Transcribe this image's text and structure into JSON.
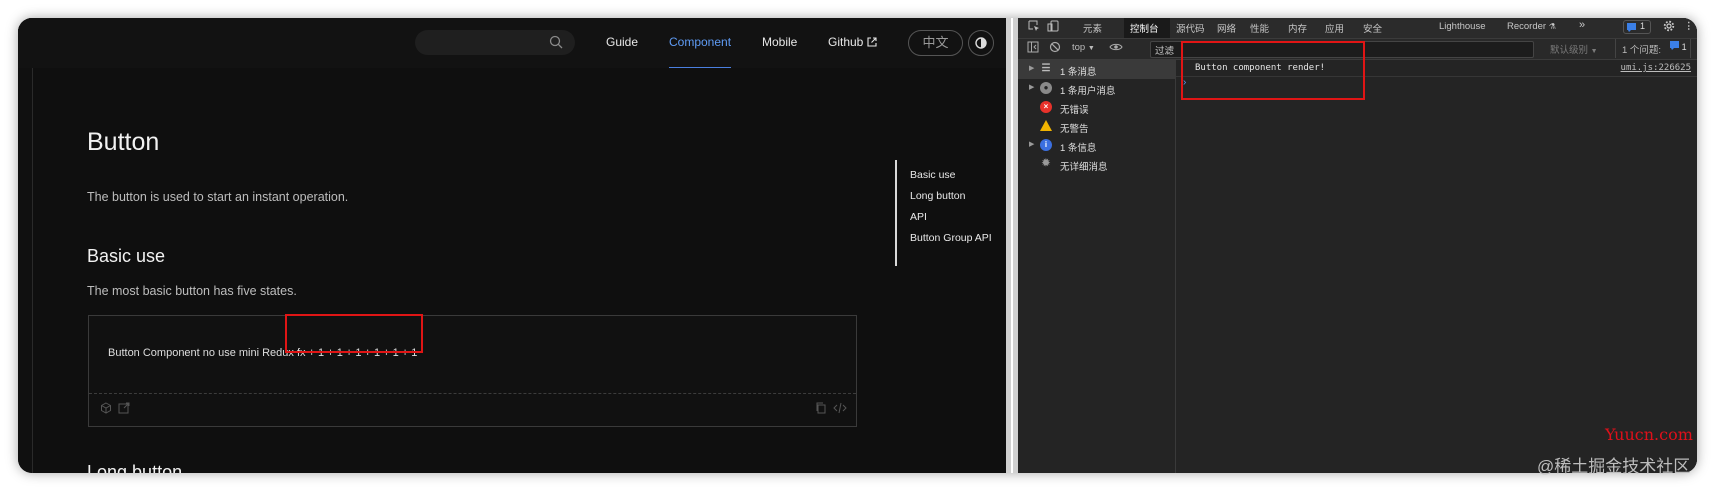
{
  "site": {
    "nav": {
      "search_placeholder": "",
      "links": [
        "Guide",
        "Component",
        "Mobile",
        "Github"
      ],
      "active": "Component",
      "lang": "中文"
    },
    "page": {
      "title": "Button",
      "intro": "The button is used to start an instant operation.",
      "section1_title": "Basic use",
      "section1_desc": "The most basic button has five states.",
      "demo_text": "Button Component no use mini Redux fx + 1 + 1 + 1 + 1 + 1 + 1",
      "section2_title": "Long button"
    },
    "toc": [
      "Basic use",
      "Long button",
      "API",
      "Button Group API"
    ]
  },
  "devtools": {
    "tabs": [
      "元素",
      "控制台",
      "源代码",
      "网络",
      "性能",
      "内存",
      "应用",
      "安全",
      "Lighthouse",
      "Recorder"
    ],
    "active_tab": "控制台",
    "issues_badge": "1",
    "toolbar": {
      "context": "top",
      "filter_value": "过滤",
      "level": "默认级别",
      "issues": "1 个问题:",
      "issues_count": "1"
    },
    "sidebar": [
      {
        "label": "1 条消息",
        "icon": "list-icon",
        "selected": true,
        "expandable": true
      },
      {
        "label": "1 条用户消息",
        "icon": "user-icon",
        "selected": false,
        "expandable": true
      },
      {
        "label": "无错误",
        "icon": "error-icon",
        "selected": false,
        "expandable": false
      },
      {
        "label": "无警告",
        "icon": "warning-icon",
        "selected": false,
        "expandable": false
      },
      {
        "label": "1 条信息",
        "icon": "info-icon",
        "selected": false,
        "expandable": true
      },
      {
        "label": "无详细消息",
        "icon": "bug-icon",
        "selected": false,
        "expandable": false
      }
    ],
    "console": {
      "message": "Button component render!",
      "source": "umi.js:226625",
      "prompt": "›"
    },
    "colors": {
      "accent": "#5f9cf5",
      "highlight_box": "#e01515"
    }
  },
  "watermarks": {
    "line1": "Yuucn.com",
    "line2": "@稀土掘金技术社区"
  }
}
